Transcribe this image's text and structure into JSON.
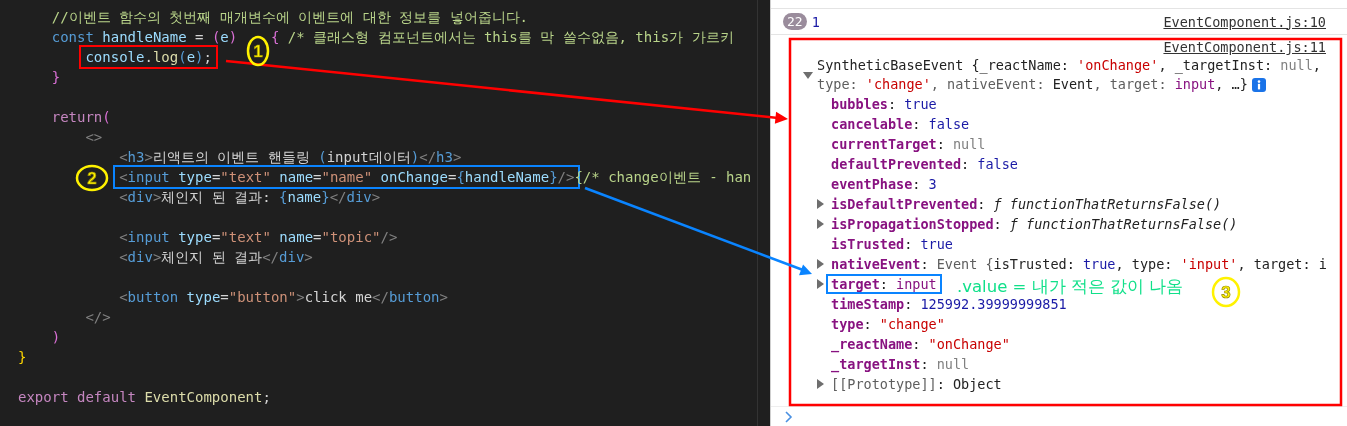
{
  "editor": {
    "blocks": [
      {
        "lines": [
          {
            "tokens": [
              {
                "text": "    //이벤트 함수의 첫번째 매개변수에 이벤트에 대한 정보를 넣어줍니다.",
                "kind": "comment"
              }
            ]
          },
          {
            "tokens": [
              {
                "text": "    const",
                "kind": "kw"
              },
              {
                "text": " handleName",
                "kind": "var"
              },
              {
                "text": " = ",
                "kind": "plain"
              },
              {
                "text": "(",
                "kind": "bracket2"
              },
              {
                "text": "e",
                "kind": "var"
              },
              {
                "text": ")",
                "kind": "bracket2"
              },
              {
                "text": "    {",
                "kind": "bracket2"
              },
              {
                "text": " /* 클래스형 컴포넌트에서는 this를 막 쓸수없음, this가 가르키",
                "kind": "comment"
              }
            ]
          },
          {
            "color": "#ff0000",
            "tokens": [
              {
                "text": "        console",
                "kind": "var"
              },
              {
                "text": ".",
                "kind": "plain"
              },
              {
                "text": "log",
                "kind": "func"
              },
              {
                "text": "(",
                "kind": "bracket3"
              },
              {
                "text": "e",
                "kind": "var"
              },
              {
                "text": ")",
                "kind": "bracket3"
              },
              {
                "text": ";",
                "kind": "plain"
              }
            ]
          },
          {
            "tokens": [
              {
                "text": "    }",
                "kind": "bracket2"
              }
            ]
          }
        ]
      },
      {
        "lines": [
          {
            "tokens": [
              {
                "text": "    return",
                "kind": "kw2"
              },
              {
                "text": "(",
                "kind": "bracket2"
              }
            ]
          },
          {
            "tokens": [
              {
                "text": "        <>",
                "kind": "tagp"
              }
            ]
          },
          {
            "tokens": [
              {
                "text": "            <",
                "kind": "tagp"
              },
              {
                "text": "h3",
                "kind": "tag"
              },
              {
                "text": ">",
                "kind": "tagp"
              },
              {
                "text": "리액트의 이벤트 핸들링 ",
                "kind": "plain"
              },
              {
                "text": "(",
                "kind": "bracket3"
              },
              {
                "text": "input데이터",
                "kind": "plain"
              },
              {
                "text": ")",
                "kind": "bracket3"
              },
              {
                "text": "</",
                "kind": "tagp"
              },
              {
                "text": "h3",
                "kind": "tag"
              },
              {
                "text": ">",
                "kind": "tagp"
              }
            ]
          },
          {
            "color": "#0a84ff",
            "tokens": [
              {
                "text": "            <",
                "kind": "tagp"
              },
              {
                "text": "input",
                "kind": "tag"
              },
              {
                "text": " type",
                "kind": "attr"
              },
              {
                "text": "=",
                "kind": "plain"
              },
              {
                "text": "\"text\"",
                "kind": "str"
              },
              {
                "text": " name",
                "kind": "attr"
              },
              {
                "text": "=",
                "kind": "plain"
              },
              {
                "text": "\"name\"",
                "kind": "str"
              },
              {
                "text": " onChange",
                "kind": "attr"
              },
              {
                "text": "=",
                "kind": "plain"
              },
              {
                "text": "{",
                "kind": "bracket3"
              },
              {
                "text": "handleName",
                "kind": "var"
              },
              {
                "text": "}",
                "kind": "bracket3"
              },
              {
                "text": "/>",
                "kind": "tagp"
              },
              {
                "text": "{/* change이벤트 - han",
                "kind": "comment"
              }
            ]
          },
          {
            "tokens": [
              {
                "text": "            <",
                "kind": "tagp"
              },
              {
                "text": "div",
                "kind": "tag"
              },
              {
                "text": ">",
                "kind": "tagp"
              },
              {
                "text": "체인지 된 결과: ",
                "kind": "plain"
              },
              {
                "text": "{",
                "kind": "bracket3"
              },
              {
                "text": "name",
                "kind": "var"
              },
              {
                "text": "}",
                "kind": "bracket3"
              },
              {
                "text": "</",
                "kind": "tagp"
              },
              {
                "text": "div",
                "kind": "tag"
              },
              {
                "text": ">",
                "kind": "tagp"
              }
            ]
          }
        ]
      },
      {
        "lines": [
          {
            "tokens": [
              {
                "text": "            <",
                "kind": "tagp"
              },
              {
                "text": "input",
                "kind": "tag"
              },
              {
                "text": " type",
                "kind": "attr"
              },
              {
                "text": "=",
                "kind": "plain"
              },
              {
                "text": "\"text\"",
                "kind": "str"
              },
              {
                "text": " name",
                "kind": "attr"
              },
              {
                "text": "=",
                "kind": "plain"
              },
              {
                "text": "\"topic\"",
                "kind": "str"
              },
              {
                "text": "/>",
                "kind": "tagp"
              }
            ]
          },
          {
            "tokens": [
              {
                "text": "            <",
                "kind": "tagp"
              },
              {
                "text": "div",
                "kind": "tag"
              },
              {
                "text": ">",
                "kind": "tagp"
              },
              {
                "text": "체인지 된 결과",
                "kind": "plain"
              },
              {
                "text": "</",
                "kind": "tagp"
              },
              {
                "text": "div",
                "kind": "tag"
              },
              {
                "text": ">",
                "kind": "tagp"
              }
            ]
          }
        ]
      },
      {
        "lines": [
          {
            "tokens": [
              {
                "text": "            <",
                "kind": "tagp"
              },
              {
                "text": "button",
                "kind": "tag"
              },
              {
                "text": " type",
                "kind": "attr"
              },
              {
                "text": "=",
                "kind": "plain"
              },
              {
                "text": "\"button\"",
                "kind": "str"
              },
              {
                "text": ">",
                "kind": "tagp"
              },
              {
                "text": "click me",
                "kind": "plain"
              },
              {
                "text": "</",
                "kind": "tagp"
              },
              {
                "text": "button",
                "kind": "tag"
              },
              {
                "text": ">",
                "kind": "tagp"
              }
            ]
          },
          {
            "tokens": [
              {
                "text": "        </>",
                "kind": "tagp"
              }
            ]
          },
          {
            "tokens": [
              {
                "text": "    )",
                "kind": "bracket2"
              }
            ]
          },
          {
            "tokens": [
              {
                "text": "}",
                "kind": "bracket1"
              }
            ]
          }
        ]
      },
      {
        "lines": [
          {
            "tokens": [
              {
                "text": "export",
                "kind": "kw2"
              },
              {
                "text": " default",
                "kind": "kw2"
              },
              {
                "text": " EventComponent",
                "kind": "func"
              },
              {
                "text": ";",
                "kind": "plain"
              }
            ]
          }
        ]
      }
    ]
  },
  "console": {
    "message": {
      "count": "22",
      "text": "1",
      "source": "EventComponent.js:10"
    },
    "event_log": {
      "source": "EventComponent.js:11",
      "expanded": true,
      "summary": [
        [
          {
            "text": "SyntheticBaseEvent {_reactName: ",
            "kind": "plain"
          },
          {
            "text": "'onChange'",
            "kind": "str"
          },
          {
            "text": ", _targetInst: ",
            "kind": "plain"
          },
          {
            "text": "null",
            "kind": "null"
          },
          {
            "text": ",",
            "kind": "plain"
          }
        ],
        [
          {
            "text": "type: ",
            "kind": "dim"
          },
          {
            "text": "'change'",
            "kind": "str"
          },
          {
            "text": ", nativeEvent: ",
            "kind": "dim"
          },
          {
            "text": "Event",
            "kind": "plain"
          },
          {
            "text": ", target: ",
            "kind": "dim"
          },
          {
            "text": "input",
            "kind": "ref"
          },
          {
            "text": ", …}",
            "kind": "plain"
          }
        ]
      ],
      "properties": [
        {
          "key": "bubbles",
          "expandable": false,
          "internal": false,
          "value": [
            {
              "text": ": ",
              "kind": "plain"
            },
            {
              "text": "true",
              "kind": "kw"
            }
          ]
        },
        {
          "key": "cancelable",
          "expandable": false,
          "internal": false,
          "value": [
            {
              "text": ": ",
              "kind": "plain"
            },
            {
              "text": "false",
              "kind": "kw"
            }
          ]
        },
        {
          "key": "currentTarget",
          "expandable": false,
          "internal": false,
          "value": [
            {
              "text": ": ",
              "kind": "plain"
            },
            {
              "text": "null",
              "kind": "null"
            }
          ]
        },
        {
          "key": "defaultPrevented",
          "expandable": false,
          "internal": false,
          "value": [
            {
              "text": ": ",
              "kind": "plain"
            },
            {
              "text": "false",
              "kind": "kw"
            }
          ]
        },
        {
          "key": "eventPhase",
          "expandable": false,
          "internal": false,
          "value": [
            {
              "text": ": ",
              "kind": "plain"
            },
            {
              "text": "3",
              "kind": "kw"
            }
          ]
        },
        {
          "key": "isDefaultPrevented",
          "expandable": true,
          "internal": false,
          "value": [
            {
              "text": ": ",
              "kind": "plain"
            },
            {
              "text": "ƒ functionThatReturnsFalse()",
              "kind": "func"
            }
          ]
        },
        {
          "key": "isPropagationStopped",
          "expandable": true,
          "internal": false,
          "value": [
            {
              "text": ": ",
              "kind": "plain"
            },
            {
              "text": "ƒ functionThatReturnsFalse()",
              "kind": "func"
            }
          ]
        },
        {
          "key": "isTrusted",
          "expandable": false,
          "internal": false,
          "value": [
            {
              "text": ": ",
              "kind": "plain"
            },
            {
              "text": "true",
              "kind": "kw"
            }
          ]
        },
        {
          "key": "nativeEvent",
          "expandable": true,
          "internal": false,
          "value": [
            {
              "text": ": ",
              "kind": "plain"
            },
            {
              "text": "Event {",
              "kind": "dim"
            },
            {
              "text": "isTrusted: ",
              "kind": "plain"
            },
            {
              "text": "true",
              "kind": "kw"
            },
            {
              "text": ", type: ",
              "kind": "plain"
            },
            {
              "text": "'input'",
              "kind": "str"
            },
            {
              "text": ", target: i",
              "kind": "plain"
            }
          ]
        },
        {
          "key": "target",
          "expandable": true,
          "internal": false,
          "color": "#0a84ff",
          "value": [
            {
              "text": ": ",
              "kind": "plain"
            },
            {
              "text": "input",
              "kind": "ref"
            }
          ]
        },
        {
          "key": "timeStamp",
          "expandable": false,
          "internal": false,
          "value": [
            {
              "text": ": ",
              "kind": "plain"
            },
            {
              "text": "125992.39999999851",
              "kind": "kw"
            }
          ]
        },
        {
          "key": "type",
          "expandable": false,
          "internal": false,
          "value": [
            {
              "text": ": ",
              "kind": "plain"
            },
            {
              "text": "\"change\"",
              "kind": "str"
            }
          ]
        },
        {
          "key": "_reactName",
          "expandable": false,
          "internal": false,
          "value": [
            {
              "text": ": ",
              "kind": "plain"
            },
            {
              "text": "\"onChange\"",
              "kind": "str"
            }
          ]
        },
        {
          "key": "_targetInst",
          "expandable": false,
          "internal": false,
          "value": [
            {
              "text": ": ",
              "kind": "plain"
            },
            {
              "text": "null",
              "kind": "null"
            }
          ]
        },
        {
          "key": "[[Prototype]]",
          "expandable": true,
          "internal": true,
          "value": [
            {
              "text": ": ",
              "kind": "plain"
            },
            {
              "text": "Object",
              "kind": "plain"
            }
          ]
        }
      ]
    }
  },
  "annotations": {
    "numbers": [
      "1",
      "2",
      "3"
    ],
    "note": ".value = 내가 적은 값이 나옴"
  }
}
